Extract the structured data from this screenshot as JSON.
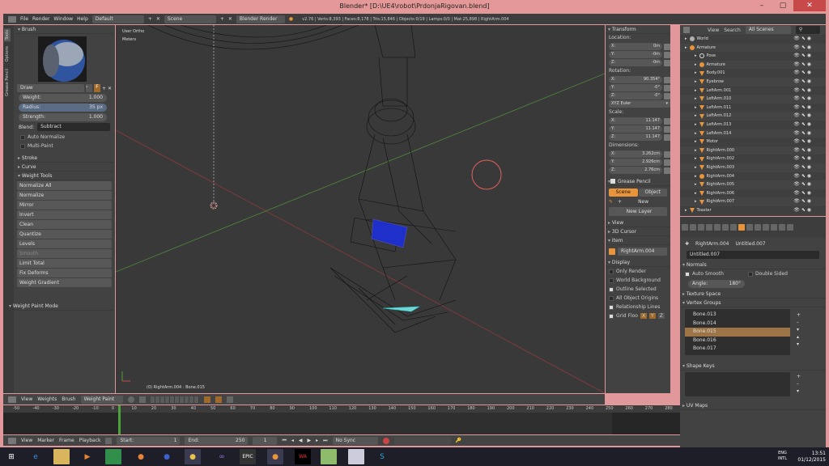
{
  "window": {
    "title": "Blender* [D:\\UE4\\robot\\PrdonjaRigovan.blend]",
    "min": "–",
    "max": "▢",
    "close": "✕"
  },
  "info_header": {
    "menus": [
      "File",
      "Render",
      "Window",
      "Help"
    ],
    "screen_layout": "Default",
    "scene": "Scene",
    "engine": "Blender Render",
    "stats": "v2.76 | Verts:8,393 | Faces:8,178 | Tris:15,846 | Objects:0/19 | Lamps:0/0 | Mat:25,898 | RightArm.004"
  },
  "tool_tabs": [
    "Tools",
    "Options",
    "Grease Pencil"
  ],
  "brush": {
    "panel": "Brush",
    "name": "Draw",
    "weight": {
      "label": "Weight:",
      "value": "1.000"
    },
    "radius": {
      "label": "Radius:",
      "value": "35 px"
    },
    "strength": {
      "label": "Strength:",
      "value": "1.000"
    },
    "blend_label": "Blend:",
    "blend_value": "Subtract",
    "auto_normalize": "Auto Normalize",
    "multi_paint": "Multi-Paint"
  },
  "tool_panels": {
    "stroke": "Stroke",
    "curve": "Curve",
    "weight_tools": "Weight Tools",
    "weight_paint_mode": "Weight Paint Mode"
  },
  "weight_tools": [
    "Normalize All",
    "Normalize",
    "Mirror",
    "Invert",
    "Clean",
    "Quantize",
    "Levels",
    "Smooth",
    "Limit Total",
    "Fix Deforms",
    "Weight Gradient"
  ],
  "viewport": {
    "view_name": "User Ortho",
    "units": "Meters",
    "object_info": "(0) RightArm.004 : Bone.015"
  },
  "viewport_header": {
    "menus": [
      "View",
      "Weights",
      "Brush"
    ],
    "mode": "Weight Paint"
  },
  "transform": {
    "panel": "Transform",
    "location_label": "Location:",
    "location": [
      {
        "axis": "X:",
        "value": "0m"
      },
      {
        "axis": "Y:",
        "value": "-0m"
      },
      {
        "axis": "Z:",
        "value": "-0m"
      }
    ],
    "rotation_label": "Rotation:",
    "rotation": [
      {
        "axis": "X:",
        "value": "90.354°"
      },
      {
        "axis": "Y:",
        "value": "-0°"
      },
      {
        "axis": "Z:",
        "value": "-0°"
      }
    ],
    "rotation_mode": "XYZ Euler",
    "scale_label": "Scale:",
    "scale": [
      {
        "axis": "X:",
        "value": "11.147"
      },
      {
        "axis": "Y:",
        "value": "11.147"
      },
      {
        "axis": "Z:",
        "value": "11.147"
      }
    ],
    "dimensions_label": "Dimensions:",
    "dimensions": [
      {
        "axis": "X:",
        "value": "3.262cm"
      },
      {
        "axis": "Y:",
        "value": "2.926cm"
      },
      {
        "axis": "Z:",
        "value": "2.76cm"
      }
    ]
  },
  "grease_pencil": {
    "panel": "Grease Pencil",
    "tab_scene": "Scene",
    "tab_object": "Object",
    "new": "New",
    "new_layer": "New Layer"
  },
  "npanels": {
    "view": "View",
    "cursor": "3D Cursor",
    "item": "Item",
    "item_name": "RightArm.004",
    "display": "Display"
  },
  "display": {
    "only_render": "Only Render",
    "world_background": "World Background",
    "outline_selected": "Outline Selected",
    "all_object_origins": "All Object Origins",
    "relationship_lines": "Relationship Lines",
    "grid_floor": "Grid Floo",
    "axes": [
      "X",
      "Y",
      "Z"
    ]
  },
  "outliner": {
    "header": {
      "view": "View",
      "search": "Search",
      "scope": "All Scenes"
    },
    "items": [
      {
        "name": "World",
        "indent": 0,
        "icon": "world"
      },
      {
        "name": "Armature",
        "indent": 0,
        "icon": "arm"
      },
      {
        "name": "Pose",
        "indent": 1,
        "icon": "pose"
      },
      {
        "name": "Armature",
        "indent": 1,
        "icon": "arm"
      },
      {
        "name": "Body.001",
        "indent": 1,
        "icon": "bone"
      },
      {
        "name": "Eyebrow",
        "indent": 1,
        "icon": "bone"
      },
      {
        "name": "LeftArm.001",
        "indent": 1,
        "icon": "bone"
      },
      {
        "name": "LeftArm.010",
        "indent": 1,
        "icon": "bone"
      },
      {
        "name": "LeftArm.011",
        "indent": 1,
        "icon": "bone"
      },
      {
        "name": "LeftArm.012",
        "indent": 1,
        "icon": "bone"
      },
      {
        "name": "LeftArm.013",
        "indent": 1,
        "icon": "bone"
      },
      {
        "name": "LeftArm.014",
        "indent": 1,
        "icon": "bone"
      },
      {
        "name": "Motor",
        "indent": 1,
        "icon": "bone"
      },
      {
        "name": "RightArm.000",
        "indent": 1,
        "icon": "bone"
      },
      {
        "name": "RightArm.002",
        "indent": 1,
        "icon": "bone"
      },
      {
        "name": "RightArm.003",
        "indent": 1,
        "icon": "bone"
      },
      {
        "name": "RightArm.004",
        "indent": 1,
        "icon": "arm"
      },
      {
        "name": "RightArm.005",
        "indent": 1,
        "icon": "bone"
      },
      {
        "name": "RightArm.006",
        "indent": 1,
        "icon": "bone"
      },
      {
        "name": "RightArm.007",
        "indent": 1,
        "icon": "bone"
      },
      {
        "name": "Toaster",
        "indent": 0,
        "icon": "bone"
      }
    ]
  },
  "properties": {
    "crumbs": [
      "RightArm.004",
      "Untitled.007"
    ],
    "mesh_name": "Untitled.007",
    "normals_panel": "Normals",
    "auto_smooth": "Auto Smooth",
    "double_sided": "Double Sided",
    "angle_label": "Angle:",
    "angle_value": "180°",
    "texture_space": "Texture Space",
    "vertex_groups": "Vertex Groups",
    "groups": [
      "Bone.013",
      "Bone.014",
      "Bone.015",
      "Bone.016",
      "Bone.017"
    ],
    "selected_group": "Bone.015",
    "shape_keys": "Shape Keys",
    "uv_maps": "UV Maps"
  },
  "timeline": {
    "ticks": [
      "-50",
      "-40",
      "-30",
      "-20",
      "-10",
      "0",
      "10",
      "20",
      "30",
      "40",
      "50",
      "60",
      "70",
      "80",
      "90",
      "100",
      "110",
      "120",
      "130",
      "140",
      "150",
      "160",
      "170",
      "180",
      "190",
      "200",
      "210",
      "220",
      "230",
      "240",
      "250",
      "260",
      "270",
      "280"
    ],
    "current_frame": "1",
    "menus": [
      "View",
      "Marker",
      "Frame",
      "Playback"
    ],
    "start_label": "Start:",
    "start": "1",
    "end_label": "End:",
    "end": "250",
    "frame": "1",
    "sync": "No Sync"
  },
  "taskbar": {
    "lang_top": "ENG",
    "lang_bottom": "INTL",
    "time": "13:51",
    "date": "01/12/2015"
  }
}
